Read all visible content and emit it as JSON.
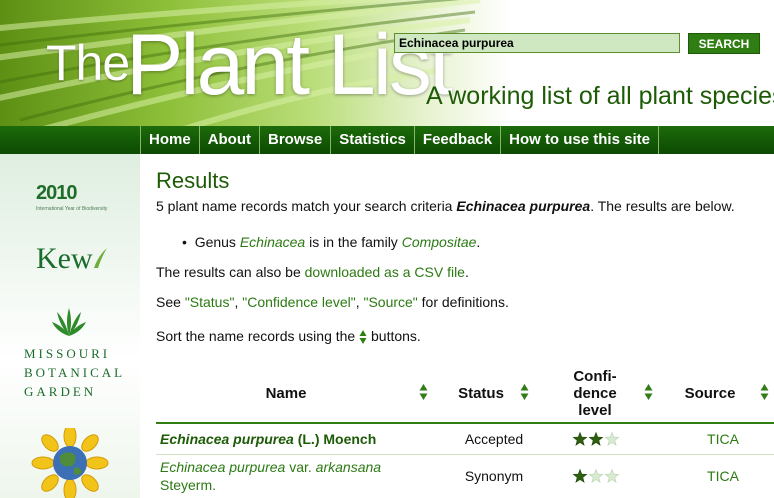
{
  "search": {
    "value": "Echinacea purpurea",
    "button": "SEARCH"
  },
  "header": {
    "logo_the": "The",
    "logo_plant_list": "Plant List",
    "tagline": "A working list of all plant species"
  },
  "nav": {
    "items": [
      "Home",
      "About",
      "Browse",
      "Statistics",
      "Feedback",
      "How to use this site"
    ]
  },
  "sidebar": {
    "biodiversity_logo": "2010",
    "biodiversity_subtext": "International Year of Biodiversity",
    "kew": "Kew",
    "mbg_lines": [
      "Missouri",
      "Botanical",
      "Garden"
    ]
  },
  "results": {
    "title": "Results",
    "summary_prefix": "5 plant name records match your search criteria ",
    "summary_query": "Echinacea purpurea",
    "summary_suffix": ". The results are below.",
    "genus_prefix": "Genus ",
    "genus_name": "Echinacea",
    "genus_middle": " is in the family ",
    "family_name": "Compositae",
    "genus_end": ".",
    "csv_prefix": "The results can also be ",
    "csv_link": "downloaded as a CSV file",
    "csv_end": ".",
    "defs_prefix": "See ",
    "defs_status": "\"Status\"",
    "defs_comma1": ", ",
    "defs_confidence": "\"Confidence level\"",
    "defs_comma2": ", ",
    "defs_source": "\"Source\"",
    "defs_suffix": " for definitions.",
    "sort_prefix": "Sort the name records using the ",
    "sort_suffix": " buttons."
  },
  "table": {
    "headers": {
      "name": "Name",
      "status": "Status",
      "confidence_lines": [
        "Confi-",
        "dence",
        "level"
      ],
      "source": "Source"
    },
    "rows": [
      {
        "name_italic": "Echinacea purpurea",
        "name_author": " (L.) Moench",
        "status": "Accepted",
        "confidence": 2,
        "confidence_max": 3,
        "source": "TICA"
      },
      {
        "name_italic": "Echinacea purpurea",
        "name_rank": " var. ",
        "name_infra": "arkansana",
        "name_author": "Steyerm.",
        "status": "Synonym",
        "confidence": 1,
        "confidence_max": 3,
        "source": "TICA"
      }
    ]
  },
  "colors": {
    "brand_green": "#1d5b06",
    "link_green": "#2b7a12",
    "nav_green": "#0d4a03",
    "star_filled": "#2f5e10",
    "star_empty": "#d9ead3"
  }
}
